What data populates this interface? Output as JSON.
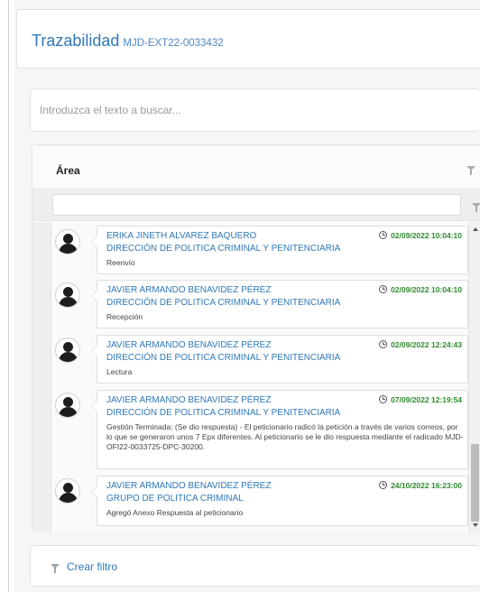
{
  "header": {
    "title": "Trazabilidad",
    "code": "MJD-EXT22-0033432"
  },
  "search": {
    "placeholder": "Introduzca el texto a buscar..."
  },
  "grid": {
    "column_title": "Área",
    "column_filter_icon": "filter-icon",
    "filter_row_icon": "filter-icon"
  },
  "entries": [
    {
      "name": "ERIKA JINETH ALVAREZ BAQUERO",
      "department": "DIRECCIÓN DE POLITICA CRIMINAL Y PENITENCIARIA",
      "description": "Reenvío",
      "timestamp": "02/09/2022 10:04:10"
    },
    {
      "name": "JAVIER ARMANDO BENAVIDEZ PÉREZ",
      "department": "DIRECCIÓN DE POLITICA CRIMINAL Y PENITENCIARIA",
      "description": "Recepción",
      "timestamp": "02/09/2022 10:04:10"
    },
    {
      "name": "JAVIER ARMANDO BENAVIDEZ PÉREZ",
      "department": "DIRECCIÓN DE POLITICA CRIMINAL Y PENITENCIARIA",
      "description": "Lectura",
      "timestamp": "02/09/2022 12:24:43"
    },
    {
      "name": "JAVIER ARMANDO BENAVIDEZ PÉREZ",
      "department": "DIRECCIÓN DE POLITICA CRIMINAL Y PENITENCIARIA",
      "description": "Gestión Terminada: (Se dio respuesta) - El peticionario radicó la petición a través de varios correos, por lo que se generaron unos 7 Epx diferentes. Al peticionario se le dio respuesta mediante el radicado MJD-OFI22-0033725-DPC-30200.",
      "timestamp": "07/09/2022 12:19:54"
    },
    {
      "name": "JAVIER ARMANDO BENAVIDEZ PÉREZ",
      "department": "GRUPO DE POLITICA CRIMINAL",
      "description": "Agregó Anexo Respuesta al peticionario",
      "timestamp": "24/10/2022 16:23:00"
    }
  ],
  "footer": {
    "create_filter_label": "Crear filtro",
    "icon": "filter-icon"
  },
  "colors": {
    "link_blue": "#2f78b8",
    "timestamp_green": "#2e8b2e"
  }
}
